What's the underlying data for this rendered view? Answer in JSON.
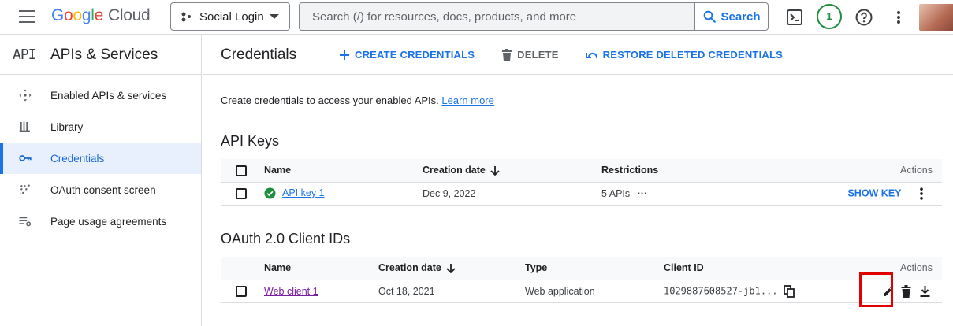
{
  "topbar": {
    "logo": {
      "g": "G",
      "o1": "o",
      "o2": "o",
      "g2": "g",
      "l": "l",
      "e": "e",
      "cloud": "Cloud"
    },
    "project": "Social Login",
    "search_placeholder": "Search (/) for resources, docs, products, and more",
    "search_button": "Search",
    "notifications_count": "1"
  },
  "sidebar": {
    "mark": "API",
    "title": "APIs & Services",
    "items": [
      {
        "label": "Enabled APIs & services",
        "icon": "diamond-arrows-icon"
      },
      {
        "label": "Library",
        "icon": "library-icon"
      },
      {
        "label": "Credentials",
        "icon": "key-icon",
        "active": true
      },
      {
        "label": "OAuth consent screen",
        "icon": "consent-dots-icon"
      },
      {
        "label": "Page usage agreements",
        "icon": "settings-list-icon"
      }
    ]
  },
  "main": {
    "title": "Credentials",
    "actions": {
      "create": "CREATE CREDENTIALS",
      "delete": "DELETE",
      "restore": "RESTORE DELETED CREDENTIALS"
    },
    "intro_text": "Create credentials to access your enabled APIs.",
    "learn_more": "Learn more",
    "api_keys": {
      "heading": "API Keys",
      "columns": {
        "name": "Name",
        "created": "Creation date",
        "restrictions": "Restrictions",
        "actions": "Actions"
      },
      "rows": [
        {
          "name": "API key 1",
          "created": "Dec 9, 2022",
          "restrictions": "5 APIs",
          "more": "···",
          "show_key": "SHOW KEY"
        }
      ]
    },
    "oauth": {
      "heading": "OAuth 2.0 Client IDs",
      "columns": {
        "name": "Name",
        "created": "Creation date",
        "type": "Type",
        "client_id": "Client ID",
        "actions": "Actions"
      },
      "rows": [
        {
          "name": "Web client 1",
          "created": "Oct 18, 2021",
          "type": "Web application",
          "client_id": "1029887608527-jb1..."
        }
      ]
    }
  },
  "colors": {
    "accent": "#1a73e8",
    "highlight": "#e00000",
    "success": "#1e8e3e"
  }
}
